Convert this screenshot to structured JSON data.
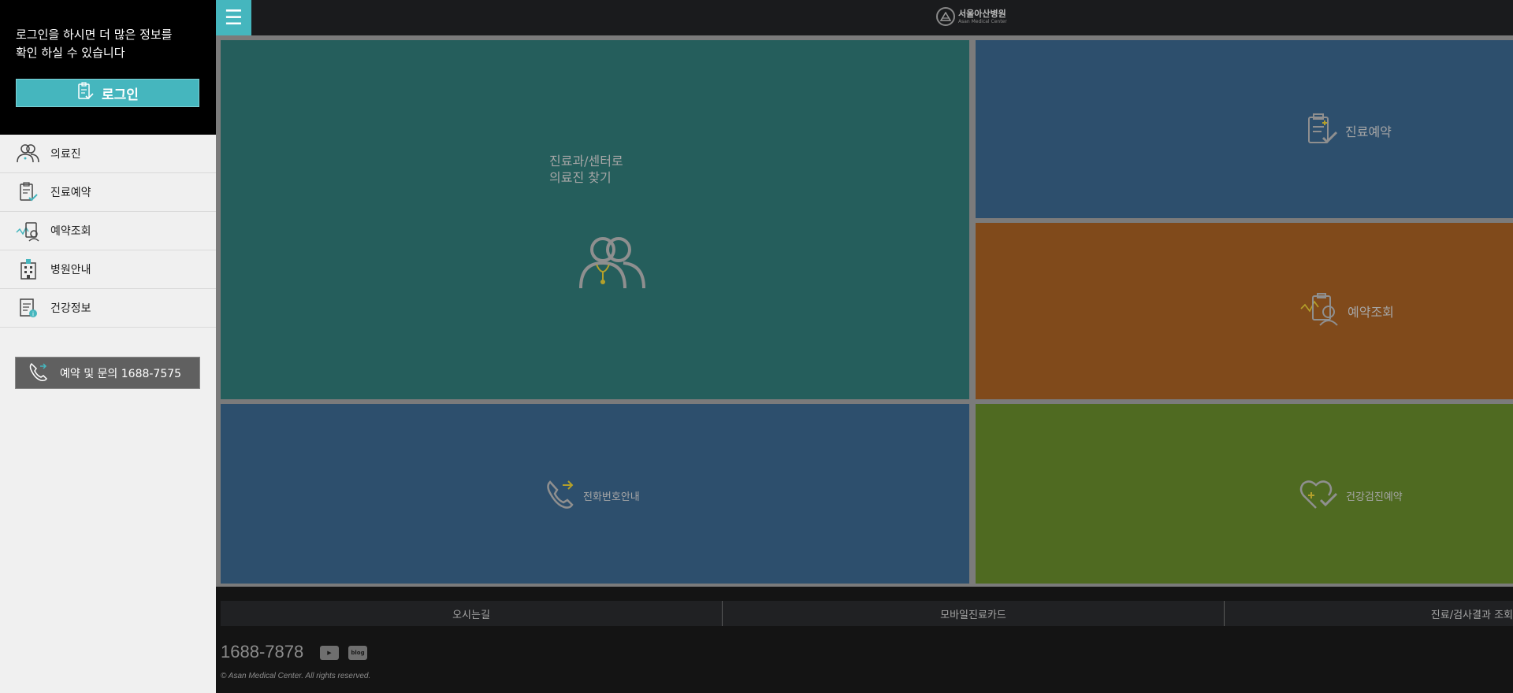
{
  "sidebar": {
    "login_message": "로그인을 하시면 더 많은 정보를\n확인 하실 수 있습니다",
    "login_button": "로그인",
    "items": [
      {
        "label": "의료진",
        "icon": "doctors-icon"
      },
      {
        "label": "진료예약",
        "icon": "clipboard-check-icon"
      },
      {
        "label": "예약조회",
        "icon": "reservation-search-icon"
      },
      {
        "label": "병원안내",
        "icon": "hospital-building-icon"
      },
      {
        "label": "건강정보",
        "icon": "health-info-icon"
      }
    ],
    "call_button": "예약 및 문의 1688-7575"
  },
  "header": {
    "logo_ko": "서울아산병원",
    "logo_en": "Asan Medical Center"
  },
  "tiles": {
    "doctor": {
      "title": "진료과/센터로\n의료진 찾기",
      "color": "#255e5c"
    },
    "reserve": {
      "label": "진료예약",
      "color": "#2d4f6d"
    },
    "check": {
      "label": "예약조회",
      "color": "#804a1b"
    },
    "phone": {
      "label": "전화번호안내",
      "color": "#2d4f6d"
    },
    "health": {
      "label": "건강검진예약",
      "color": "#4f6a21"
    }
  },
  "footer": {
    "links": [
      "오시는길",
      "모바일진료카드",
      "진료/검사결과 조회"
    ],
    "phone": "1688-7878",
    "youtube": "▶",
    "blog": "blog",
    "copyright": "© Asan Medical Center. All rights reserved."
  },
  "colors": {
    "accent": "#45b6be",
    "icon_yellow": "#b4a02a"
  }
}
